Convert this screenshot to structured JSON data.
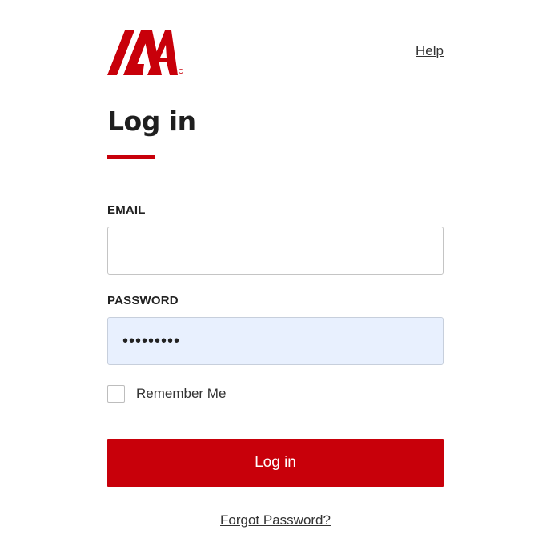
{
  "header": {
    "logo_text": "IAA",
    "help_label": "Help"
  },
  "form": {
    "title": "Log in",
    "email": {
      "label": "EMAIL",
      "value": "",
      "placeholder": ""
    },
    "password": {
      "label": "PASSWORD",
      "value": "•••••••••"
    },
    "remember_me": {
      "label": "Remember Me",
      "checked": false
    },
    "submit_label": "Log in",
    "forgot_password_label": "Forgot Password?"
  },
  "colors": {
    "brand_red": "#c8000a",
    "autofill_bg": "#e8f0fe"
  }
}
